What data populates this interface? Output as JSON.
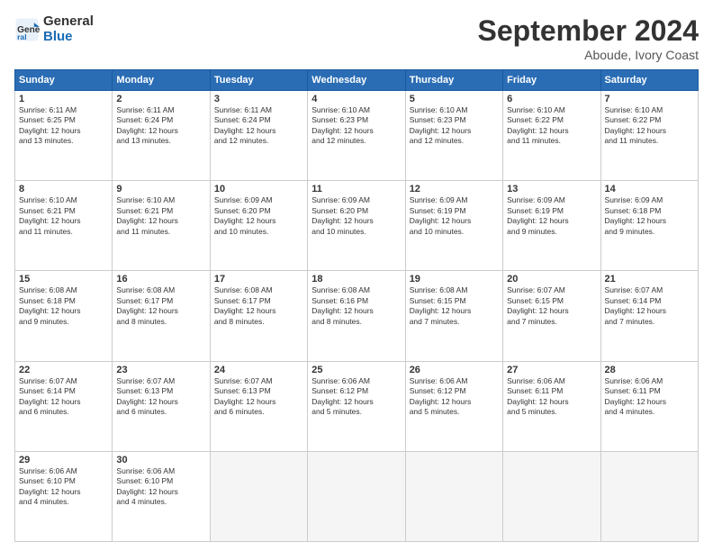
{
  "logo": {
    "line1": "General",
    "line2": "Blue"
  },
  "title": "September 2024",
  "subtitle": "Aboude, Ivory Coast",
  "headers": [
    "Sunday",
    "Monday",
    "Tuesday",
    "Wednesday",
    "Thursday",
    "Friday",
    "Saturday"
  ],
  "weeks": [
    [
      {
        "day": "1",
        "info": "Sunrise: 6:11 AM\nSunset: 6:25 PM\nDaylight: 12 hours\nand 13 minutes."
      },
      {
        "day": "2",
        "info": "Sunrise: 6:11 AM\nSunset: 6:24 PM\nDaylight: 12 hours\nand 13 minutes."
      },
      {
        "day": "3",
        "info": "Sunrise: 6:11 AM\nSunset: 6:24 PM\nDaylight: 12 hours\nand 12 minutes."
      },
      {
        "day": "4",
        "info": "Sunrise: 6:10 AM\nSunset: 6:23 PM\nDaylight: 12 hours\nand 12 minutes."
      },
      {
        "day": "5",
        "info": "Sunrise: 6:10 AM\nSunset: 6:23 PM\nDaylight: 12 hours\nand 12 minutes."
      },
      {
        "day": "6",
        "info": "Sunrise: 6:10 AM\nSunset: 6:22 PM\nDaylight: 12 hours\nand 11 minutes."
      },
      {
        "day": "7",
        "info": "Sunrise: 6:10 AM\nSunset: 6:22 PM\nDaylight: 12 hours\nand 11 minutes."
      }
    ],
    [
      {
        "day": "8",
        "info": "Sunrise: 6:10 AM\nSunset: 6:21 PM\nDaylight: 12 hours\nand 11 minutes."
      },
      {
        "day": "9",
        "info": "Sunrise: 6:10 AM\nSunset: 6:21 PM\nDaylight: 12 hours\nand 11 minutes."
      },
      {
        "day": "10",
        "info": "Sunrise: 6:09 AM\nSunset: 6:20 PM\nDaylight: 12 hours\nand 10 minutes."
      },
      {
        "day": "11",
        "info": "Sunrise: 6:09 AM\nSunset: 6:20 PM\nDaylight: 12 hours\nand 10 minutes."
      },
      {
        "day": "12",
        "info": "Sunrise: 6:09 AM\nSunset: 6:19 PM\nDaylight: 12 hours\nand 10 minutes."
      },
      {
        "day": "13",
        "info": "Sunrise: 6:09 AM\nSunset: 6:19 PM\nDaylight: 12 hours\nand 9 minutes."
      },
      {
        "day": "14",
        "info": "Sunrise: 6:09 AM\nSunset: 6:18 PM\nDaylight: 12 hours\nand 9 minutes."
      }
    ],
    [
      {
        "day": "15",
        "info": "Sunrise: 6:08 AM\nSunset: 6:18 PM\nDaylight: 12 hours\nand 9 minutes."
      },
      {
        "day": "16",
        "info": "Sunrise: 6:08 AM\nSunset: 6:17 PM\nDaylight: 12 hours\nand 8 minutes."
      },
      {
        "day": "17",
        "info": "Sunrise: 6:08 AM\nSunset: 6:17 PM\nDaylight: 12 hours\nand 8 minutes."
      },
      {
        "day": "18",
        "info": "Sunrise: 6:08 AM\nSunset: 6:16 PM\nDaylight: 12 hours\nand 8 minutes."
      },
      {
        "day": "19",
        "info": "Sunrise: 6:08 AM\nSunset: 6:15 PM\nDaylight: 12 hours\nand 7 minutes."
      },
      {
        "day": "20",
        "info": "Sunrise: 6:07 AM\nSunset: 6:15 PM\nDaylight: 12 hours\nand 7 minutes."
      },
      {
        "day": "21",
        "info": "Sunrise: 6:07 AM\nSunset: 6:14 PM\nDaylight: 12 hours\nand 7 minutes."
      }
    ],
    [
      {
        "day": "22",
        "info": "Sunrise: 6:07 AM\nSunset: 6:14 PM\nDaylight: 12 hours\nand 6 minutes."
      },
      {
        "day": "23",
        "info": "Sunrise: 6:07 AM\nSunset: 6:13 PM\nDaylight: 12 hours\nand 6 minutes."
      },
      {
        "day": "24",
        "info": "Sunrise: 6:07 AM\nSunset: 6:13 PM\nDaylight: 12 hours\nand 6 minutes."
      },
      {
        "day": "25",
        "info": "Sunrise: 6:06 AM\nSunset: 6:12 PM\nDaylight: 12 hours\nand 5 minutes."
      },
      {
        "day": "26",
        "info": "Sunrise: 6:06 AM\nSunset: 6:12 PM\nDaylight: 12 hours\nand 5 minutes."
      },
      {
        "day": "27",
        "info": "Sunrise: 6:06 AM\nSunset: 6:11 PM\nDaylight: 12 hours\nand 5 minutes."
      },
      {
        "day": "28",
        "info": "Sunrise: 6:06 AM\nSunset: 6:11 PM\nDaylight: 12 hours\nand 4 minutes."
      }
    ],
    [
      {
        "day": "29",
        "info": "Sunrise: 6:06 AM\nSunset: 6:10 PM\nDaylight: 12 hours\nand 4 minutes."
      },
      {
        "day": "30",
        "info": "Sunrise: 6:06 AM\nSunset: 6:10 PM\nDaylight: 12 hours\nand 4 minutes."
      },
      {
        "day": "",
        "info": ""
      },
      {
        "day": "",
        "info": ""
      },
      {
        "day": "",
        "info": ""
      },
      {
        "day": "",
        "info": ""
      },
      {
        "day": "",
        "info": ""
      }
    ]
  ]
}
